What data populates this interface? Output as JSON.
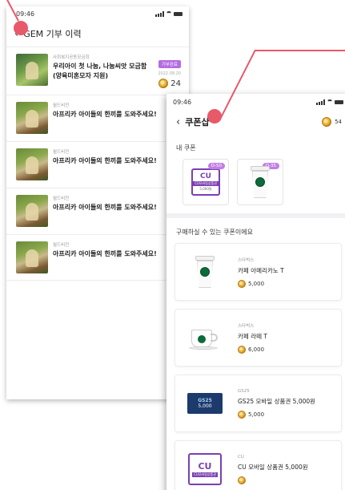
{
  "colors": {
    "accent_pink": "#e8596a",
    "badge_purple": "#b56ce0",
    "coupon_tag": "#c27ee5"
  },
  "screen1": {
    "status_time": "09:46",
    "header_title": "GEM 기부 이력",
    "items": [
      {
        "subtitle": "사회복지공동모금회",
        "title": "우리아이 첫 나눔, 나눔씨앗 모금함 (양육미혼모자 지원)",
        "badge": "기부완료",
        "date": "2022.08.20",
        "gems": "24",
        "thumb": "child-photo"
      },
      {
        "subtitle": "월드비전",
        "title": "아프리카 아이들의 한끼를 도와주세요!",
        "thumb": "child-photo"
      },
      {
        "subtitle": "월드비전",
        "title": "아프리카 아이들의 한끼를 도와주세요!",
        "thumb": "child-photo"
      },
      {
        "subtitle": "월드비전",
        "title": "아프리카 아이들의 한끼를 도와주세요!",
        "thumb": "child-photo"
      },
      {
        "subtitle": "월드비전",
        "title": "아프리카 아이들의 한끼를 도와주세요!",
        "thumb": "child-photo"
      }
    ]
  },
  "screen2": {
    "status_time": "09:46",
    "header_title": "쿠폰샵",
    "points": "54",
    "my_coupons_label": "내 쿠폰",
    "my_coupons": [
      {
        "tag": "D-50",
        "brand": "CU",
        "line": "CU모바일상품권",
        "amount": "5,000원"
      },
      {
        "tag": "D-35",
        "brand": "starbucks"
      }
    ],
    "purchasable_label": "구매하실 수 있는 쿠폰이에요",
    "coupons": [
      {
        "brand": "스타벅스",
        "name": "카페 아메리카노 T",
        "price": "5,000",
        "image": "starbucks-cup"
      },
      {
        "brand": "스타벅스",
        "name": "카페 라떼 T",
        "price": "6,000",
        "image": "starbucks-mug"
      },
      {
        "brand": "GS25",
        "name": "GS25 모바일 상품권 5,000원",
        "price": "5,000",
        "image_brand": "GS25",
        "image_value": "5,000"
      },
      {
        "brand": "CU",
        "name": "CU 모바일 상품권 5,000원",
        "price": "",
        "image_brand": "CU",
        "image_line": "CU모바일상품권"
      }
    ]
  }
}
